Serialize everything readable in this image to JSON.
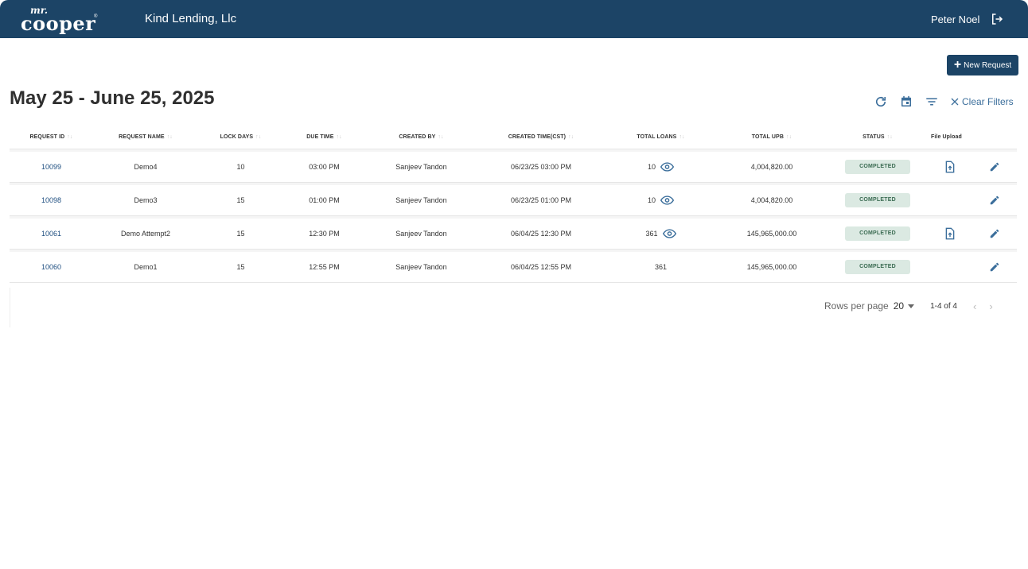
{
  "header": {
    "logo_small": "mr.",
    "logo_big": "cooper",
    "logo_reg": "®",
    "company": "Kind Lending, Llc",
    "user_name": "Peter Noel"
  },
  "actions": {
    "new_request_label": "New Request"
  },
  "page": {
    "title": "May 25 - June 25, 2025"
  },
  "toolbar": {
    "clear_filters_label": "Clear Filters"
  },
  "table": {
    "columns": [
      {
        "label": "REQUEST ID",
        "sortable": true
      },
      {
        "label": "REQUEST NAME",
        "sortable": true
      },
      {
        "label": "LOCK DAYS",
        "sortable": true
      },
      {
        "label": "DUE TIME",
        "sortable": true
      },
      {
        "label": "CREATED BY",
        "sortable": true
      },
      {
        "label": "CREATED TIME(CST)",
        "sortable": true
      },
      {
        "label": "TOTAL LOANS",
        "sortable": true
      },
      {
        "label": "TOTAL UPB",
        "sortable": true
      },
      {
        "label": "STATUS",
        "sortable": true
      },
      {
        "label": "File Upload",
        "sortable": false
      }
    ],
    "rows": [
      {
        "id": "10099",
        "name": "Demo4",
        "lock_days": "10",
        "due_time": "03:00 PM",
        "created_by": "Sanjeev Tandon",
        "created_time": "06/23/25 03:00 PM",
        "total_loans": "10",
        "total_upb": "4,004,820.00",
        "status": "COMPLETED"
      },
      {
        "id": "10098",
        "name": "Demo3",
        "lock_days": "15",
        "due_time": "01:00 PM",
        "created_by": "Sanjeev Tandon",
        "created_time": "06/23/25 01:00 PM",
        "total_loans": "10",
        "total_upb": "4,004,820.00",
        "status": "COMPLETED"
      },
      {
        "id": "10061",
        "name": "Demo Attempt2",
        "lock_days": "15",
        "due_time": "12:30 PM",
        "created_by": "Sanjeev Tandon",
        "created_time": "06/04/25 12:30 PM",
        "total_loans": "361",
        "total_upb": "145,965,000.00",
        "status": "COMPLETED"
      },
      {
        "id": "10060",
        "name": "Demo1",
        "lock_days": "15",
        "due_time": "12:55 PM",
        "created_by": "Sanjeev Tandon",
        "created_time": "06/04/25 12:55 PM",
        "total_loans": "361",
        "total_upb": "145,965,000.00",
        "status": "COMPLETED"
      }
    ]
  },
  "pagination": {
    "rows_per_page_label": "Rows per page",
    "rows_per_page_value": "20",
    "range": "1-4 of 4"
  },
  "colors": {
    "header_bg": "#1c4466",
    "link": "#1f4f80",
    "status_bg": "#dbe9e2",
    "status_text": "#3a6b52"
  },
  "icons": {
    "logout": "logout-icon",
    "refresh": "refresh-icon",
    "calendar": "calendar-icon",
    "filter": "filter-icon",
    "close": "close-icon",
    "eye": "eye-icon",
    "upload": "upload-icon",
    "edit": "pencil-icon"
  }
}
